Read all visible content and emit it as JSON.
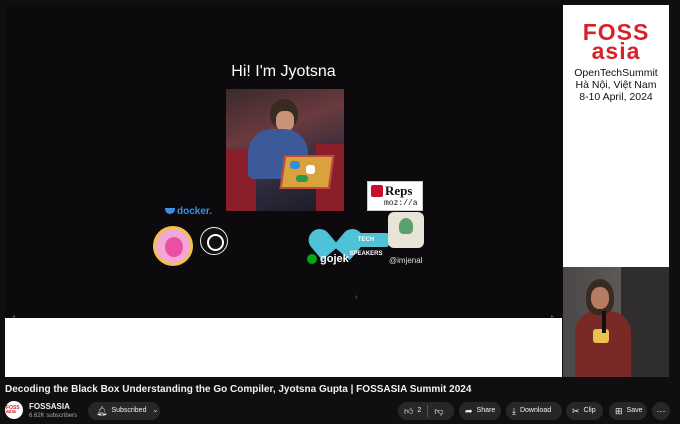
{
  "slide": {
    "title": "Hi! I'm Jyotsna",
    "docker_label": "docker.",
    "reps_label": "Reps",
    "reps_sub": "moz://a",
    "tech_speakers_label": "TECH SPEAKERS",
    "gojek_label": "gojek",
    "handle": "@imjenal",
    "nav_dot": "›"
  },
  "event": {
    "logo_line1": "FOSS",
    "logo_line2": "asia",
    "name": "OpenTechSummit",
    "location": "Hà Nội, Việt Nam",
    "dates": "8-10 April, 2024"
  },
  "video": {
    "title": "Decoding the Black Box Understanding the Go Compiler, Jyotsna Gupta | FOSSASIA Summit 2024"
  },
  "channel": {
    "name": "FOSSASIA",
    "subscribers": "6.62K subscribers",
    "avatar_text": "FOSS asia"
  },
  "actions": {
    "subscribe_label": "Subscribed",
    "like_count": "2",
    "share_label": "Share",
    "download_label": "Download",
    "clip_label": "Clip",
    "save_label": "Save"
  },
  "icons": {
    "bell": "bell-icon",
    "chevron": "chevron-down-icon",
    "thumb_up": "thumb-up-icon",
    "thumb_down": "thumb-down-icon",
    "share": "share-icon",
    "download": "download-icon",
    "clip": "scissors-icon",
    "save": "bookmark-icon",
    "more": "more-icon"
  },
  "colors": {
    "background": "#0f0f0f",
    "pill": "#272727",
    "fossasia_red": "#d8222a"
  }
}
